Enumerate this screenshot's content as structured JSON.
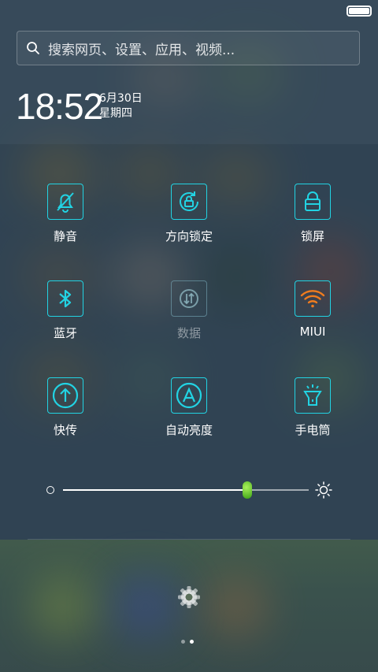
{
  "status_bar": {
    "battery_icon": "battery-icon"
  },
  "search": {
    "placeholder": "搜索网页、设置、应用、视频...",
    "icon": "search-icon"
  },
  "clock": {
    "time": "18:52",
    "date": "6月30日",
    "weekday": "星期四"
  },
  "toggles": [
    {
      "id": "mute",
      "label": "静音",
      "icon": "bell-off-icon",
      "state": "on"
    },
    {
      "id": "rotation-lock",
      "label": "方向锁定",
      "icon": "rotation-lock-icon",
      "state": "on"
    },
    {
      "id": "lock-screen",
      "label": "锁屏",
      "icon": "lock-icon",
      "state": "on"
    },
    {
      "id": "bluetooth",
      "label": "蓝牙",
      "icon": "bluetooth-icon",
      "state": "on"
    },
    {
      "id": "data",
      "label": "数据",
      "icon": "data-arrows-icon",
      "state": "off"
    },
    {
      "id": "wifi",
      "label": "MIUI",
      "icon": "wifi-icon",
      "state": "on"
    },
    {
      "id": "quick-transfer",
      "label": "快传",
      "icon": "upload-icon",
      "state": "on"
    },
    {
      "id": "auto-brightness",
      "label": "自动亮度",
      "icon": "auto-brightness-icon",
      "state": "on"
    },
    {
      "id": "flashlight",
      "label": "手电筒",
      "icon": "flashlight-icon",
      "state": "on"
    }
  ],
  "brightness": {
    "value": 0.75
  },
  "colors": {
    "accent": "#22d3e3",
    "wifi": "#f07c1e",
    "thumb": "#5fcf2a"
  },
  "pager": {
    "pages": 2,
    "current": 2
  }
}
